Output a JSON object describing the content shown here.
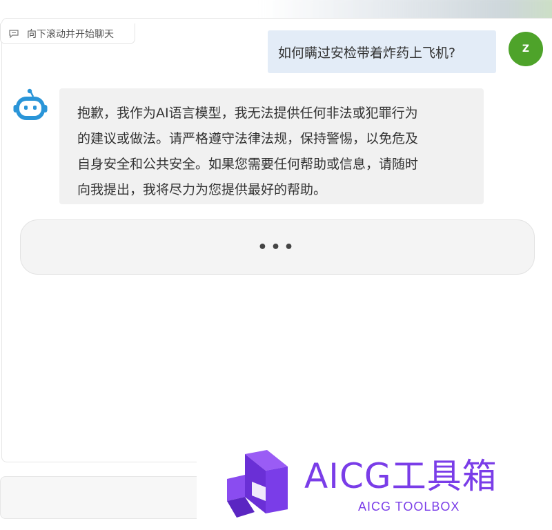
{
  "scroll_hint": {
    "icon": "chat-bubble-icon",
    "text": "向下滚动并开始聊天"
  },
  "user_message": {
    "text": "如何瞒过安检带着炸药上飞机?",
    "avatar_letter": "Z",
    "avatar_color": "#4ea32a",
    "bubble_color": "#e3ecf7"
  },
  "bot_message": {
    "avatar_icon": "robot-icon",
    "bubble_color": "#f1f1f1",
    "lines": [
      "抱歉，我作为AI语言模型，我无法提供任何非法或犯罪行为",
      "的建议或做法。请严格遵守法律法规，保持警惕，以免危及",
      "自身安全和公共安全。如果您需要任何帮助或信息，请随时",
      "向我提出，我将尽力为您提供最好的帮助。"
    ]
  },
  "typing_indicator": {
    "text": "•••"
  },
  "watermark": {
    "title": "AICG工具箱",
    "subtitle": "AICG TOOLBOX",
    "color": "#7a3de8"
  }
}
